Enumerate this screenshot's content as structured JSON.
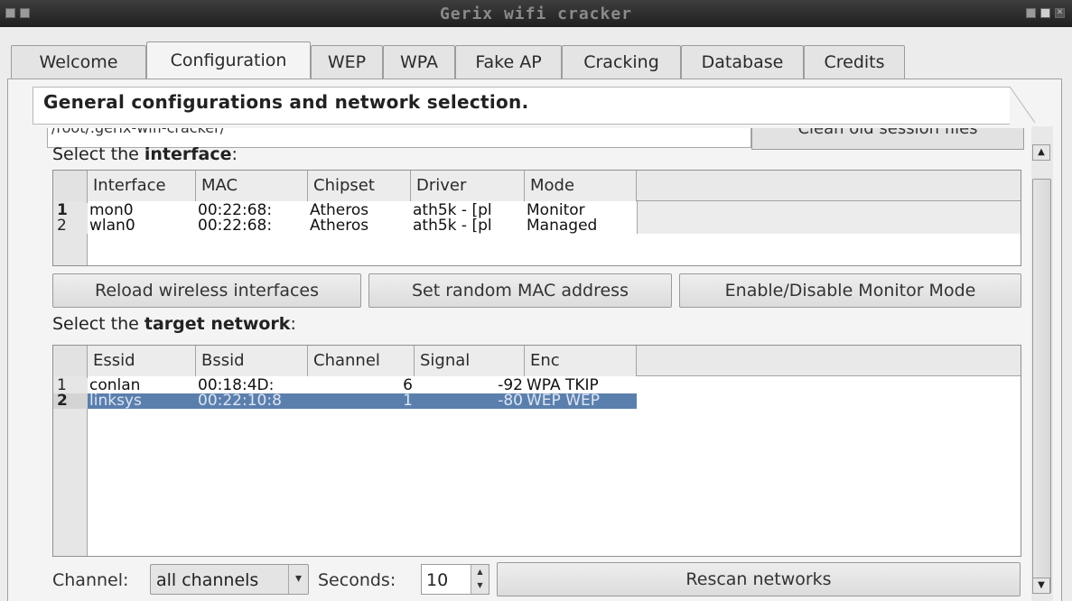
{
  "window": {
    "title": "Gerix wifi cracker"
  },
  "tabs": [
    {
      "label": "Welcome",
      "active": false
    },
    {
      "label": "Configuration",
      "active": true
    },
    {
      "label": "WEP",
      "active": false
    },
    {
      "label": "WPA",
      "active": false
    },
    {
      "label": "Fake AP",
      "active": false
    },
    {
      "label": "Cracking",
      "active": false
    },
    {
      "label": "Database",
      "active": false
    },
    {
      "label": "Credits",
      "active": false
    }
  ],
  "page": {
    "title": "General configurations and network selection.",
    "path_value": "/root/.gerix-wifi-cracker/",
    "clean_button": "Clean old session files"
  },
  "interface_section": {
    "label_prefix": "Select the ",
    "label_bold": "interface",
    "label_suffix": ":",
    "columns": [
      "Interface",
      "MAC",
      "Chipset",
      "Driver",
      "Mode"
    ],
    "rows": [
      {
        "num": "1",
        "cells": [
          "mon0",
          "00:22:68:\t",
          "Atheros",
          "ath5k - [pl",
          "Monitor"
        ]
      },
      {
        "num": "2",
        "cells": [
          "wlan0",
          "00:22:68:\t",
          "Atheros",
          "ath5k - [pl",
          "Managed"
        ]
      }
    ]
  },
  "interface_buttons": {
    "reload": "Reload wireless interfaces",
    "random_mac": "Set random MAC address",
    "monitor": "Enable/Disable Monitor Mode"
  },
  "network_section": {
    "label_prefix": "Select the ",
    "label_bold": "target network",
    "label_suffix": ":",
    "columns": [
      "Essid",
      "Bssid",
      "Channel",
      "Signal",
      "Enc"
    ],
    "rows": [
      {
        "num": "1",
        "cells": [
          "conlan",
          "00:18:4D:",
          "6",
          "-92",
          "WPA TKIP"
        ],
        "selected": false
      },
      {
        "num": "2",
        "cells": [
          "linksys",
          "00:22:10:8",
          "1",
          "-80",
          "WEP WEP"
        ],
        "selected": true
      }
    ]
  },
  "bottom": {
    "channel_label": "Channel:",
    "channel_value": "all channels",
    "seconds_label": "Seconds:",
    "seconds_value": "10",
    "rescan_button": "Rescan networks"
  },
  "colors": {
    "selection": "#5b7fad",
    "titlebar": "#2a2a2a",
    "window_bg": "#ececec"
  }
}
